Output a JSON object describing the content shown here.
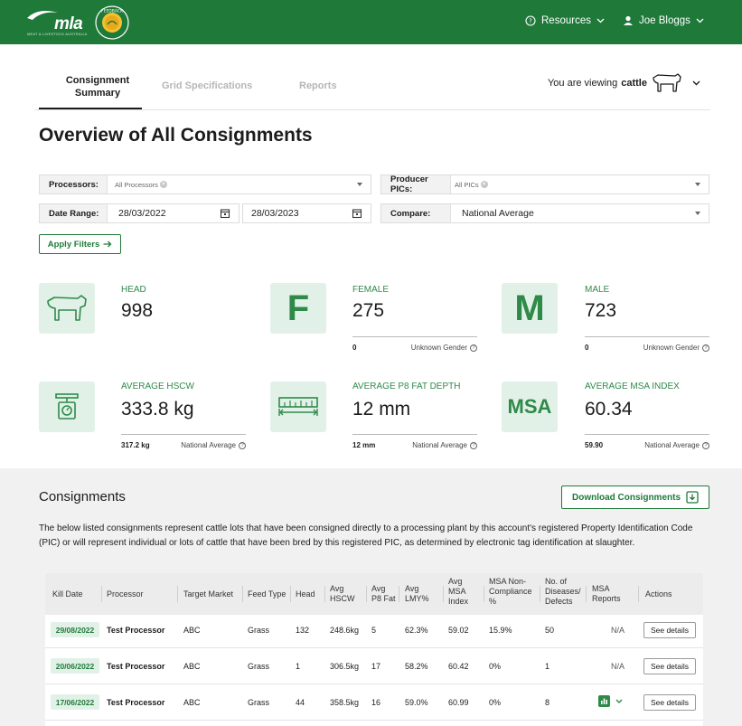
{
  "header": {
    "logo_text": "mla",
    "logo_subtext": "MEAT & LIVESTOCK AUSTRALIA",
    "seal_text": "FEEDBACK",
    "resources_label": "Resources",
    "user_label": "Joe Bloggs",
    "bg_color": "#1f7a3a"
  },
  "tabs": [
    {
      "label_line1": "Consignment",
      "label_line2": "Summary",
      "active": true
    },
    {
      "label_line1": "Grid Specifications",
      "label_line2": "",
      "active": false
    },
    {
      "label_line1": "Reports",
      "label_line2": "",
      "active": false
    }
  ],
  "viewing": {
    "prefix": "You are viewing",
    "species": "cattle"
  },
  "page_title": "Overview of All Consignments",
  "filters": {
    "processors_label": "Processors:",
    "processors_value": "All Processors",
    "pics_label": "Producer PICs:",
    "pics_value": "All PICs",
    "date_label": "Date Range:",
    "date_from": "28/03/2022",
    "date_to": "28/03/2023",
    "compare_label": "Compare:",
    "compare_value": "National Average",
    "apply_label": "Apply Filters"
  },
  "stats": {
    "head": {
      "label": "HEAD",
      "value": "998"
    },
    "female": {
      "letter": "F",
      "label": "FEMALE",
      "value": "275",
      "sub_value": "0",
      "sub_label": "Unknown Gender"
    },
    "male": {
      "letter": "M",
      "label": "MALE",
      "value": "723",
      "sub_value": "0",
      "sub_label": "Unknown Gender"
    },
    "hscw": {
      "label": "AVERAGE HSCW",
      "value": "333.8 kg",
      "sub_value": "317.2 kg",
      "sub_label": "National Average"
    },
    "p8": {
      "label": "AVERAGE P8 FAT DEPTH",
      "value": "12 mm",
      "sub_value": "12 mm",
      "sub_label": "National Average"
    },
    "msa": {
      "tile_text": "MSA",
      "label": "AVERAGE MSA INDEX",
      "value": "60.34",
      "sub_value": "59.90",
      "sub_label": "National Average"
    },
    "accent_color": "#2f8a4a"
  },
  "consignments": {
    "title": "Consignments",
    "download_label": "Download Consignments",
    "description": "The below listed consignments represent cattle lots that have been consigned directly to a processing plant by this account's registered Property Identification Code (PIC) or will represent individual or lots of cattle that have been bred by this registered PIC, as determined by electronic tag identification at slaughter.",
    "columns": [
      [
        "Kill Date"
      ],
      [
        "Processor"
      ],
      [
        "Target Market"
      ],
      [
        "Feed Type"
      ],
      [
        "Head"
      ],
      [
        "Avg",
        "HSCW"
      ],
      [
        "Avg",
        "P8 Fat"
      ],
      [
        "Avg",
        "LMY%"
      ],
      [
        "Avg",
        "MSA",
        "Index"
      ],
      [
        "MSA Non-",
        "Compliance",
        "%"
      ],
      [
        "No. of",
        "Diseases/",
        "Defects"
      ],
      [
        "MSA",
        "Reports"
      ],
      [
        "Actions"
      ]
    ],
    "rows": [
      {
        "kill_date": "29/08/2022",
        "processor": "Test Processor",
        "market": "ABC",
        "feed": "Grass",
        "head": "132",
        "hscw": "248.6kg",
        "p8": "5",
        "lmy": "62.3%",
        "msa_index": "59.02",
        "non_compliance": "15.9%",
        "defects": "50",
        "reports": "N/A",
        "action": "See details"
      },
      {
        "kill_date": "20/06/2022",
        "processor": "Test Processor",
        "market": "ABC",
        "feed": "Grass",
        "head": "1",
        "hscw": "306.5kg",
        "p8": "17",
        "lmy": "58.2%",
        "msa_index": "60.42",
        "non_compliance": "0%",
        "defects": "1",
        "reports": "N/A",
        "action": "See details"
      },
      {
        "kill_date": "17/06/2022",
        "processor": "Test Processor",
        "market": "ABC",
        "feed": "Grass",
        "head": "44",
        "hscw": "358.5kg",
        "p8": "16",
        "lmy": "59.0%",
        "msa_index": "60.99",
        "non_compliance": "0%",
        "defects": "8",
        "reports": "",
        "action": "See details"
      }
    ]
  }
}
